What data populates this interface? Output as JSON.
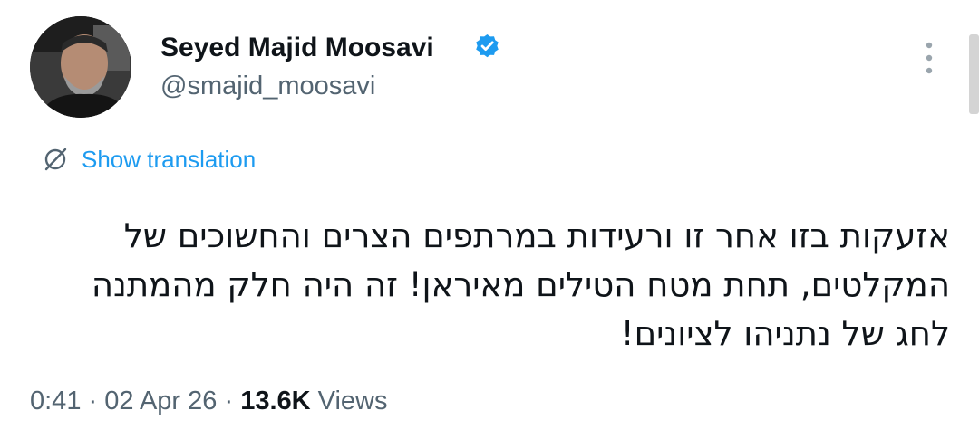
{
  "author": {
    "display_name": "Seyed Majid Moosavi",
    "handle": "@smajid_moosavi",
    "verified_color": "#1d9bf0"
  },
  "translation": {
    "label": "Show translation",
    "icon": "translate-icon"
  },
  "tweet": {
    "lines": [
      "אזעקות בזו אחר זו ורעידות במרתפים הצרים והחשוכים של",
      "המקלטים, תחת מטח הטילים מאיראן! זה היה חלק מהמתנה",
      "לחג של נתניהו לציונים!"
    ]
  },
  "meta": {
    "time": "0:41",
    "separator": "·",
    "date": "02 Apr 26",
    "views_count": "13.6K",
    "views_label": "Views"
  },
  "colors": {
    "accent": "#1d9bf0",
    "text": "#0f1419",
    "secondary": "#536471"
  }
}
